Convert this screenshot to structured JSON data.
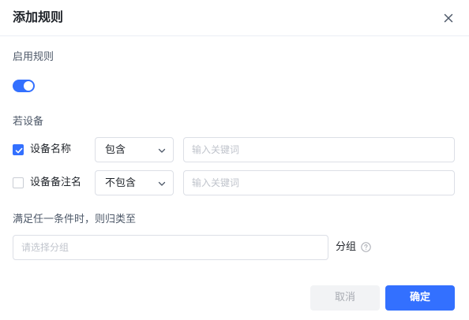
{
  "dialog": {
    "title": "添加规则",
    "close_icon": "close-icon"
  },
  "enable": {
    "label": "启用规则",
    "on": true
  },
  "condition": {
    "label": "若设备",
    "rows": [
      {
        "checked": true,
        "field": "设备名称",
        "operator": "包含",
        "placeholder": "输入关键词",
        "value": ""
      },
      {
        "checked": false,
        "field": "设备备注名",
        "operator": "不包含",
        "placeholder": "输入关键词",
        "value": ""
      }
    ]
  },
  "assign": {
    "label": "满足任一条件时，则归类至",
    "placeholder": "请选择分组",
    "suffix": "分组",
    "help_icon": "question-circle-icon"
  },
  "footer": {
    "cancel_label": "取消",
    "ok_label": "确定"
  },
  "colors": {
    "primary": "#3370ff",
    "border": "#dcdfe6",
    "placeholder": "#c0c4cc",
    "disabled_bg": "#f2f3f5"
  }
}
